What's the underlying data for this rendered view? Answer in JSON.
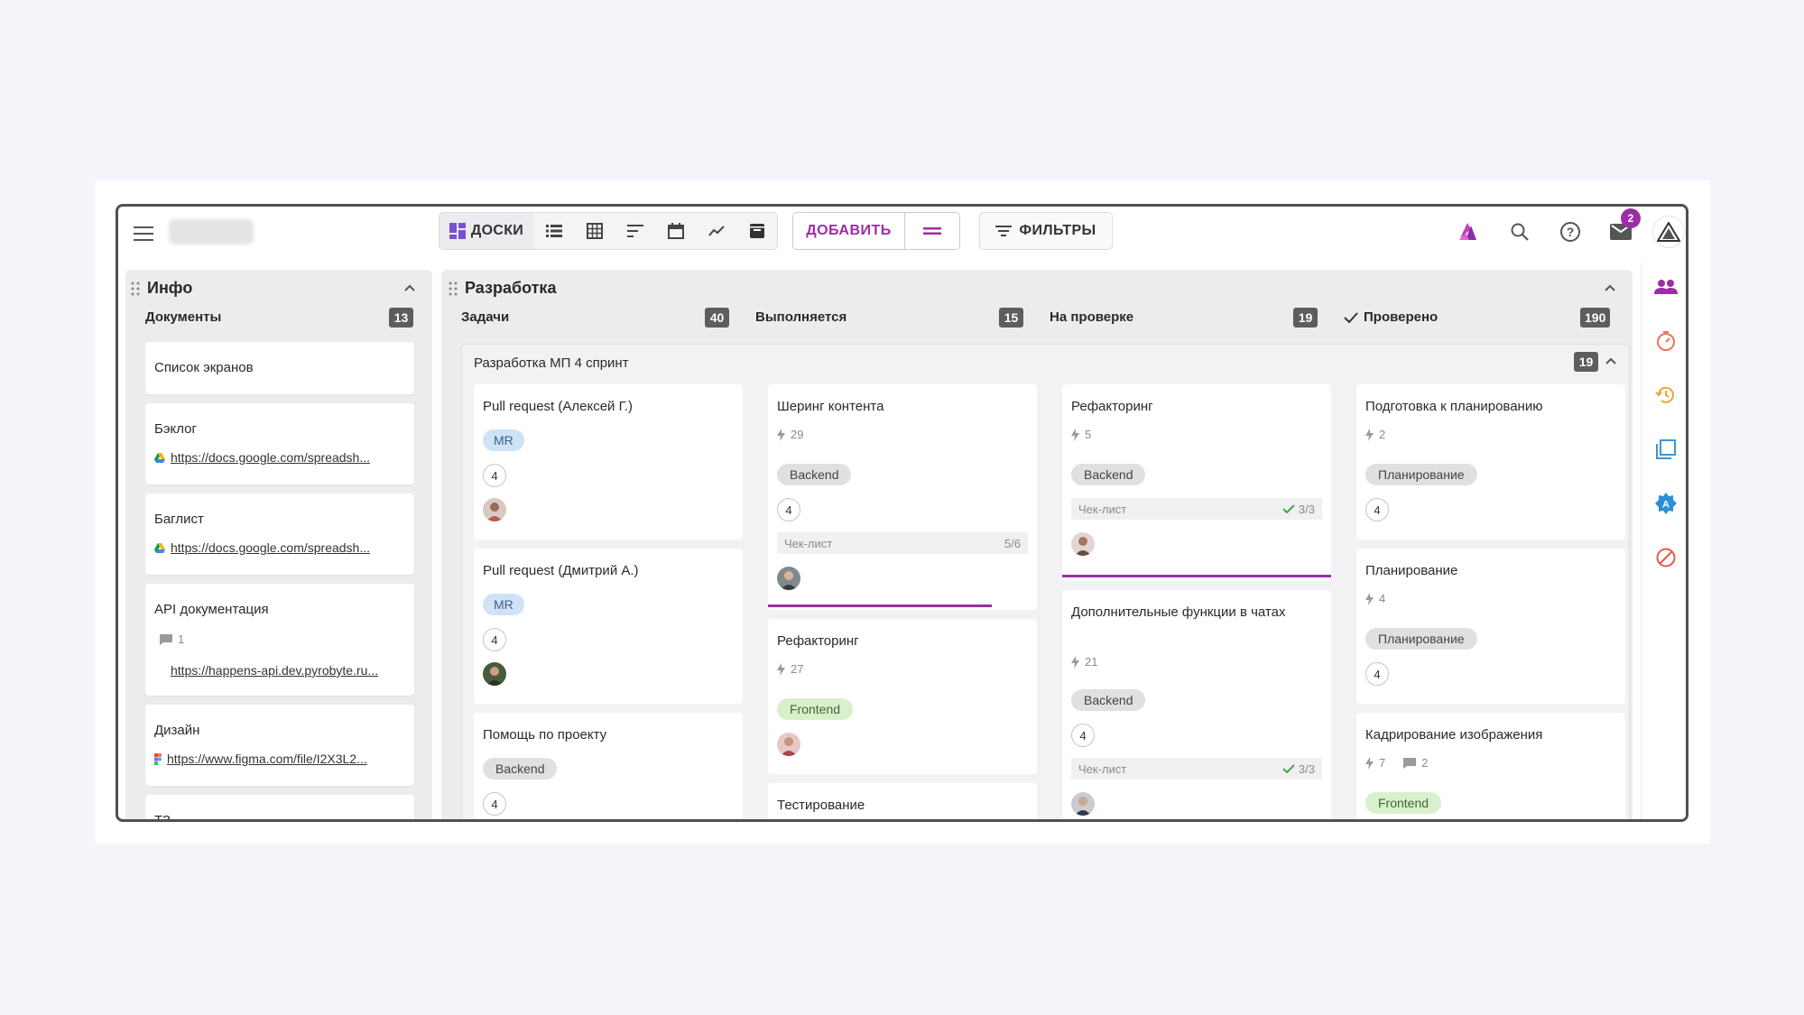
{
  "toolbar": {
    "boards_label": "ДОСКИ",
    "add_label": "ДОБАВИТЬ",
    "filters_label": "ФИЛЬТРЫ",
    "mail_badge": "2"
  },
  "info_panel": {
    "title": "Инфо",
    "column": {
      "name": "Документы",
      "count": "13"
    },
    "cards": [
      {
        "title": "Список экранов"
      },
      {
        "title": "Бэклог",
        "link": "https://docs.google.com/spreadsh..."
      },
      {
        "title": "Баглист",
        "link": "https://docs.google.com/spreadsh..."
      },
      {
        "title": "API документация",
        "comments": "1",
        "link": "https://happens-api.dev.pyrobyte.ru..."
      },
      {
        "title": "Дизайн",
        "link": "https://www.figma.com/file/I2X3L2..."
      },
      {
        "title": "ТЗ"
      }
    ]
  },
  "dev_panel": {
    "title": "Разработка",
    "columns": [
      {
        "name": "Задачи",
        "count": "40"
      },
      {
        "name": "Выполняется",
        "count": "15"
      },
      {
        "name": "На проверке",
        "count": "19"
      },
      {
        "name": "Проверено",
        "count": "190"
      }
    ],
    "swimlane": {
      "title": "Разработка МП 4 спринт",
      "count": "19"
    },
    "todo": [
      {
        "title": "Pull request (Алексей Г.)",
        "tag": "MR",
        "estimate": "4"
      },
      {
        "title": "Pull request (Дмитрий А.)",
        "tag": "MR",
        "estimate": "4"
      },
      {
        "title": "Помощь по проекту",
        "tag": "Backend",
        "estimate": "4"
      }
    ],
    "in_progress": [
      {
        "title": "Шеринг контента",
        "points": "29",
        "tag": "Backend",
        "estimate": "4",
        "checklist_label": "Чек-лист",
        "checklist_value": "5/6"
      },
      {
        "title": "Рефакторинг",
        "points": "27",
        "tag": "Frontend"
      },
      {
        "title": "Тестирование"
      }
    ],
    "review": [
      {
        "title": "Рефакторинг",
        "points": "5",
        "tag": "Backend",
        "checklist_label": "Чек-лист",
        "checklist_value": "3/3"
      },
      {
        "title": "Дополнительные функции в чатах",
        "points": "21",
        "tag": "Backend",
        "estimate": "4",
        "checklist_label": "Чек-лист",
        "checklist_value": "3/3"
      }
    ],
    "done": [
      {
        "title": "Подготовка к планированию",
        "points": "2",
        "tag": "Планирование",
        "estimate": "4"
      },
      {
        "title": "Планирование",
        "points": "4",
        "tag": "Планирование",
        "estimate": "4"
      },
      {
        "title": "Кадрирование изображения",
        "points": "7",
        "comments": "2",
        "tag": "Frontend"
      }
    ]
  },
  "colors": {
    "accent": "#9b2ea5",
    "tag_mr": "#cfe2f6",
    "tag_frontend": "#d9f0cd",
    "count_badge": "#5d5d5d"
  }
}
